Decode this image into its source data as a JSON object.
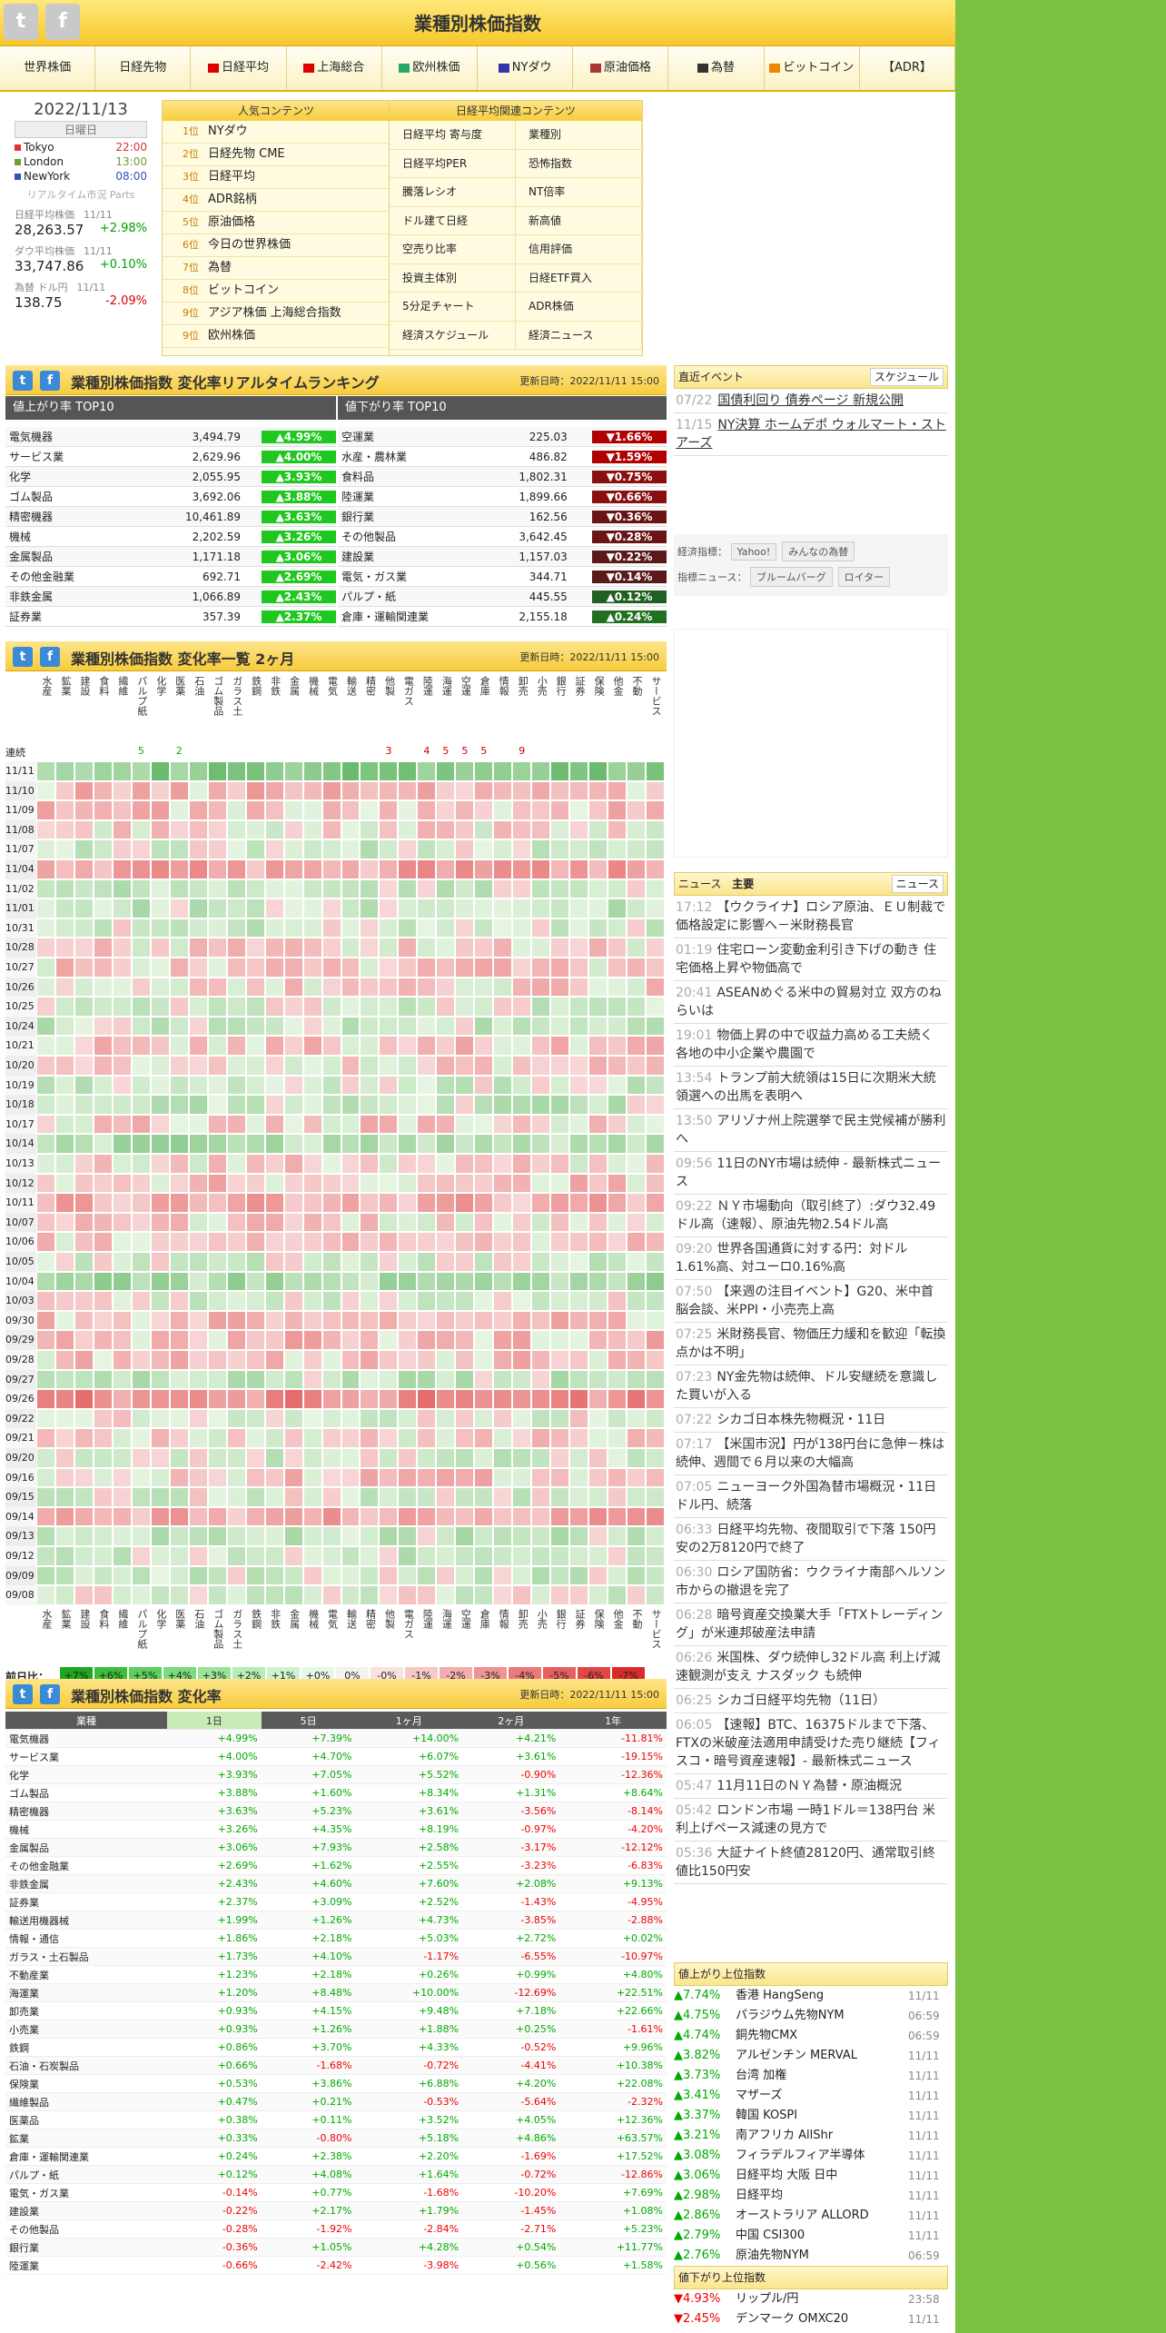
{
  "header": {
    "title": "業種別株価指数",
    "twitter": "t",
    "facebook": "f"
  },
  "nav": [
    "世界株価",
    "日経先物",
    "日経平均",
    "上海総合",
    "欧州株価",
    "NYダウ",
    "原油価格",
    "為替",
    "ビットコイン",
    "【ADR】"
  ],
  "datebox": {
    "date": "2022/11/13",
    "dow": "日曜日",
    "cities": [
      {
        "name": "Tokyo",
        "time": "22:00",
        "color": "#e03030"
      },
      {
        "name": "London",
        "time": "13:00",
        "color": "#70a030"
      },
      {
        "name": "NewYork",
        "time": "08:00",
        "color": "#3050c0"
      }
    ],
    "rt_label": "リアルタイム市況 Parts",
    "indices": [
      {
        "name": "日経平均株価",
        "date": "11/11",
        "value": "28,263.57",
        "chg": "+2.98%",
        "pos": true
      },
      {
        "name": "ダウ平均株価",
        "date": "11/11",
        "value": "33,747.86",
        "chg": "+0.10%",
        "pos": true
      },
      {
        "name": "為替 ドル円",
        "date": "11/11",
        "value": "138.75",
        "chg": "-2.09%",
        "pos": false
      }
    ]
  },
  "popular": {
    "title": "人気コンテンツ",
    "items": [
      {
        "rank": "1位",
        "label": "NYダウ"
      },
      {
        "rank": "2位",
        "label": "日経先物 CME"
      },
      {
        "rank": "3位",
        "label": "日経平均"
      },
      {
        "rank": "4位",
        "label": "ADR銘柄"
      },
      {
        "rank": "5位",
        "label": "原油価格"
      },
      {
        "rank": "6位",
        "label": "今日の世界株価"
      },
      {
        "rank": "7位",
        "label": "為替"
      },
      {
        "rank": "8位",
        "label": "ビットコイン"
      },
      {
        "rank": "9位",
        "label": "アジア株価 上海総合指数"
      },
      {
        "rank": "9位",
        "label": "欧州株価"
      }
    ]
  },
  "related": {
    "title": "日経平均関連コンテンツ",
    "left": [
      "日経平均 寄与度",
      "日経平均PER",
      "騰落レシオ",
      "ドル建て日経",
      "空売り比率",
      "投資主体別",
      "5分足チャート",
      "経済スケジュール"
    ],
    "right": [
      "業種別",
      "恐怖指数",
      "NT倍率",
      "新高値",
      "信用評価",
      "日経ETF買入",
      "ADR株価",
      "経済ニュース"
    ]
  },
  "ranking": {
    "title": "業種別株価指数 変化率リアルタイムランキング",
    "updated": "更新日時：2022/11/11 15:00",
    "up_title": "値上がり率 TOP10",
    "down_title": "値下がり率 TOP10",
    "up": [
      {
        "name": "電気機器",
        "value": "3,494.79",
        "chg": "▲4.99%"
      },
      {
        "name": "サービス業",
        "value": "2,629.96",
        "chg": "▲4.00%"
      },
      {
        "name": "化学",
        "value": "2,055.95",
        "chg": "▲3.93%"
      },
      {
        "name": "ゴム製品",
        "value": "3,692.06",
        "chg": "▲3.88%"
      },
      {
        "name": "精密機器",
        "value": "10,461.89",
        "chg": "▲3.63%"
      },
      {
        "name": "機械",
        "value": "2,202.59",
        "chg": "▲3.26%"
      },
      {
        "name": "金属製品",
        "value": "1,171.18",
        "chg": "▲3.06%"
      },
      {
        "name": "その他金融業",
        "value": "692.71",
        "chg": "▲2.69%"
      },
      {
        "name": "非鉄金属",
        "value": "1,066.89",
        "chg": "▲2.43%"
      },
      {
        "name": "証券業",
        "value": "357.39",
        "chg": "▲2.37%"
      }
    ],
    "down": [
      {
        "name": "空運業",
        "value": "225.03",
        "chg": "▼1.66%",
        "c": "#b00000"
      },
      {
        "name": "水産・農林業",
        "value": "486.82",
        "chg": "▼1.59%",
        "c": "#b00000"
      },
      {
        "name": "食料品",
        "value": "1,802.31",
        "chg": "▼0.75%",
        "c": "#8a1010"
      },
      {
        "name": "陸運業",
        "value": "1,899.66",
        "chg": "▼0.66%",
        "c": "#8a1010"
      },
      {
        "name": "銀行業",
        "value": "162.56",
        "chg": "▼0.36%",
        "c": "#6a1515"
      },
      {
        "name": "その他製品",
        "value": "3,642.45",
        "chg": "▼0.28%",
        "c": "#6a1515"
      },
      {
        "name": "建設業",
        "value": "1,157.03",
        "chg": "▼0.22%",
        "c": "#5a1a1a"
      },
      {
        "name": "電気・ガス業",
        "value": "344.71",
        "chg": "▼0.14%",
        "c": "#5a1a1a"
      },
      {
        "name": "パルプ・紙",
        "value": "445.55",
        "chg": "▲0.12%",
        "c": "#206020"
      },
      {
        "name": "倉庫・運輸関連業",
        "value": "2,155.18",
        "chg": "▲0.24%",
        "c": "#207020"
      }
    ]
  },
  "heatmap": {
    "title": "業種別株価指数 変化率一覧 2ヶ月",
    "updated": "更新日時：2022/11/11 15:00",
    "sectors": [
      "水産",
      "鉱業",
      "建設",
      "食料",
      "繊維",
      "パルプ紙",
      "化学",
      "医薬",
      "石油",
      "ゴム製品",
      "ガラス土",
      "鉄鋼",
      "非鉄",
      "金属",
      "機械",
      "電気",
      "輸送",
      "精密",
      "他製",
      "電ガス",
      "陸運",
      "海運",
      "空運",
      "倉庫",
      "情報",
      "卸売",
      "小売",
      "銀行",
      "証券",
      "保険",
      "他金",
      "不動",
      "サービス"
    ],
    "streak_label": "連続",
    "streaks": [
      "",
      "",
      "",
      "",
      "",
      "5",
      "",
      "2",
      "",
      "",
      "",
      "",
      "",
      "",
      "",
      "",
      "",
      "",
      "3",
      "",
      "4",
      "5",
      "5",
      "5",
      "",
      "9",
      "",
      "",
      "",
      "",
      "",
      "",
      ""
    ],
    "dates": [
      "11/11",
      "11/10",
      "11/09",
      "11/08",
      "11/07",
      "11/04",
      "11/02",
      "11/01",
      "10/31",
      "10/28",
      "10/27",
      "10/26",
      "10/25",
      "10/24",
      "10/21",
      "10/20",
      "10/19",
      "10/18",
      "10/17",
      "10/14",
      "10/13",
      "10/12",
      "10/11",
      "10/07",
      "10/06",
      "10/05",
      "10/04",
      "10/03",
      "09/30",
      "09/29",
      "09/28",
      "09/27",
      "09/26",
      "09/22",
      "09/21",
      "09/20",
      "09/16",
      "09/15",
      "09/14",
      "09/13",
      "09/12",
      "09/09",
      "09/08"
    ],
    "legend_label": "前日比：",
    "legend": [
      "+7%",
      "+6%",
      "+5%",
      "+4%",
      "+3%",
      "+2%",
      "+1%",
      "+0%",
      "0%",
      "-0%",
      "-1%",
      "-2%",
      "-3%",
      "-4%",
      "-5%",
      "-6%",
      "-7%"
    ]
  },
  "table": {
    "title": "業種別株価指数 変化率",
    "updated": "更新日時：2022/11/11 15:00",
    "cols": [
      "業種",
      "1日",
      "5日",
      "1ヶ月",
      "2ヶ月",
      "1年"
    ],
    "rows": [
      [
        "電気機器",
        "+4.99%",
        "+7.39%",
        "+14.00%",
        "+4.21%",
        "-11.81%"
      ],
      [
        "サービス業",
        "+4.00%",
        "+4.70%",
        "+6.07%",
        "+3.61%",
        "-19.15%"
      ],
      [
        "化学",
        "+3.93%",
        "+7.05%",
        "+5.52%",
        "-0.90%",
        "-12.36%"
      ],
      [
        "ゴム製品",
        "+3.88%",
        "+1.60%",
        "+8.34%",
        "+1.31%",
        "+8.64%"
      ],
      [
        "精密機器",
        "+3.63%",
        "+5.23%",
        "+3.61%",
        "-3.56%",
        "-8.14%"
      ],
      [
        "機械",
        "+3.26%",
        "+4.35%",
        "+8.19%",
        "-0.97%",
        "-4.20%"
      ],
      [
        "金属製品",
        "+3.06%",
        "+7.93%",
        "+2.58%",
        "-3.17%",
        "-12.12%"
      ],
      [
        "その他金融業",
        "+2.69%",
        "+1.62%",
        "+2.55%",
        "-3.23%",
        "-6.83%"
      ],
      [
        "非鉄金属",
        "+2.43%",
        "+4.60%",
        "+7.60%",
        "+2.08%",
        "+9.13%"
      ],
      [
        "証券業",
        "+2.37%",
        "+3.09%",
        "+2.52%",
        "-1.43%",
        "-4.95%"
      ],
      [
        "輸送用機器械",
        "+1.99%",
        "+1.26%",
        "+4.73%",
        "-3.85%",
        "-2.88%"
      ],
      [
        "情報・通信",
        "+1.86%",
        "+2.18%",
        "+5.03%",
        "+2.72%",
        "+0.02%"
      ],
      [
        "ガラス・土石製品",
        "+1.73%",
        "+4.10%",
        "-1.17%",
        "-6.55%",
        "-10.97%"
      ],
      [
        "不動産業",
        "+1.23%",
        "+2.18%",
        "+0.26%",
        "+0.99%",
        "+4.80%"
      ],
      [
        "海運業",
        "+1.20%",
        "+8.48%",
        "+10.00%",
        "-12.69%",
        "+22.51%"
      ],
      [
        "卸売業",
        "+0.93%",
        "+4.15%",
        "+9.48%",
        "+7.18%",
        "+22.66%"
      ],
      [
        "小売業",
        "+0.93%",
        "+1.26%",
        "+1.88%",
        "+0.25%",
        "-1.61%"
      ],
      [
        "鉄鋼",
        "+0.86%",
        "+3.70%",
        "+4.33%",
        "-0.52%",
        "+9.96%"
      ],
      [
        "石油・石炭製品",
        "+0.66%",
        "-1.68%",
        "-0.72%",
        "-4.41%",
        "+10.38%"
      ],
      [
        "保険業",
        "+0.53%",
        "+3.86%",
        "+6.88%",
        "+4.20%",
        "+22.08%"
      ],
      [
        "繊維製品",
        "+0.47%",
        "+0.21%",
        "-0.53%",
        "-5.64%",
        "-2.32%"
      ],
      [
        "医薬品",
        "+0.38%",
        "+0.11%",
        "+3.52%",
        "+4.05%",
        "+12.36%"
      ],
      [
        "鉱業",
        "+0.33%",
        "-0.80%",
        "+5.18%",
        "+4.86%",
        "+63.57%"
      ],
      [
        "倉庫・運輸関連業",
        "+0.24%",
        "+2.38%",
        "+2.20%",
        "-1.69%",
        "+17.52%"
      ],
      [
        "パルプ・紙",
        "+0.12%",
        "+4.08%",
        "+1.64%",
        "-0.72%",
        "-12.86%"
      ],
      [
        "電気・ガス業",
        "-0.14%",
        "+0.77%",
        "-1.68%",
        "-10.20%",
        "+7.69%"
      ],
      [
        "建設業",
        "-0.22%",
        "+2.17%",
        "+1.79%",
        "-1.45%",
        "+1.08%"
      ],
      [
        "その他製品",
        "-0.28%",
        "-1.92%",
        "-2.84%",
        "-2.71%",
        "+5.23%"
      ],
      [
        "銀行業",
        "-0.36%",
        "+1.05%",
        "+4.28%",
        "+0.54%",
        "+11.77%"
      ],
      [
        "陸運業",
        "-0.66%",
        "-2.42%",
        "-3.98%",
        "+0.56%",
        "+1.58%"
      ]
    ]
  },
  "events": {
    "title": "直近イベント",
    "button": "スケジュール",
    "items": [
      {
        "date": "07/22",
        "text": "国債利回り 債券ページ 新規公開"
      },
      {
        "date": "11/15",
        "text": "NY決算 ホームデポ ウォルマート・ストアーズ"
      }
    ],
    "econ_label": "経済指標：",
    "econ_links": [
      "Yahoo!",
      "みんなの為替"
    ],
    "news_label": "指標ニュース：",
    "news_links": [
      "ブルームバーグ",
      "ロイター"
    ]
  },
  "news": {
    "title": "ニュース",
    "tab": "主要",
    "button": "ニュース",
    "items": [
      {
        "t": "17:12",
        "x": "【ウクライナ】ロシア原油、ＥＵ制裁で価格設定に影響へ－米財務長官"
      },
      {
        "t": "01:19",
        "x": "住宅ローン変動金利引き下げの動き 住宅価格上昇や物価高で"
      },
      {
        "t": "20:41",
        "x": "ASEANめぐる米中の貿易対立 双方のねらいは"
      },
      {
        "t": "19:01",
        "x": "物価上昇の中で収益力高める工夫続く 各地の中小企業や農園で"
      },
      {
        "t": "13:54",
        "x": "トランプ前大統領は15日に次期米大統領選への出馬を表明へ"
      },
      {
        "t": "13:50",
        "x": "アリゾナ州上院選挙で民主党候補が勝利へ"
      },
      {
        "t": "09:56",
        "x": "11日のNY市場は続伸 - 最新株式ニュース"
      },
      {
        "t": "09:22",
        "x": "ＮＹ市場動向（取引終了）:ダウ32.49ドル高（速報）、原油先物2.54ドル高"
      },
      {
        "t": "09:20",
        "x": "世界各国通貨に対する円：対ドル1.61%高、対ユーロ0.16%高"
      },
      {
        "t": "07:50",
        "x": "【来週の注目イベント】G20、米中首脳会談、米PPI・小売売上高"
      },
      {
        "t": "07:25",
        "x": "米財務長官、物価圧力緩和を歓迎「転換点かは不明」"
      },
      {
        "t": "07:23",
        "x": "NY金先物は続伸、ドル安継続を意識した買いが入る"
      },
      {
        "t": "07:22",
        "x": "シカゴ日本株先物概況・11日"
      },
      {
        "t": "07:17",
        "x": "【米国市況】円が138円台に急伸－株は続伸、週間で６月以来の大幅高"
      },
      {
        "t": "07:05",
        "x": "ニューヨーク外国為替市場概況・11日 ドル円、続落"
      },
      {
        "t": "06:33",
        "x": "日経平均先物、夜間取引で下落 150円安の2万8120円で終了"
      },
      {
        "t": "06:30",
        "x": "ロシア国防省：ウクライナ南部ヘルソン市からの撤退を完了"
      },
      {
        "t": "06:28",
        "x": "暗号資産交換業大手「FTXトレーディング」が米連邦破産法申請"
      },
      {
        "t": "06:26",
        "x": "米国株、ダウ続伸し32ドル高 利上げ減速観測が支え ナスダック も続伸"
      },
      {
        "t": "06:25",
        "x": "シカゴ日経平均先物（11日）"
      },
      {
        "t": "06:05",
        "x": "【速報】BTC、16375ドルまで下落、FTXの米破産法適用申請受けた売り継続【フィスコ・暗号資産速報】- 最新株式ニュース"
      },
      {
        "t": "05:47",
        "x": "11月11日のＮＹ為替・原油概況"
      },
      {
        "t": "05:42",
        "x": "ロンドン市場 一時1ドル＝138円台 米利上げペース減速の見方で"
      },
      {
        "t": "05:36",
        "x": "大証ナイト終値28120円、通常取引終値比150円安"
      }
    ]
  },
  "gainers": {
    "title": "値上がり上位指数",
    "items": [
      {
        "c": "▲7.74%",
        "n": "香港 HangSeng",
        "d": "11/11"
      },
      {
        "c": "▲4.75%",
        "n": "パラジウム先物NYM",
        "d": "06:59"
      },
      {
        "c": "▲4.74%",
        "n": "銅先物CMX",
        "d": "06:59"
      },
      {
        "c": "▲3.82%",
        "n": "アルゼンチン MERVAL",
        "d": "11/11"
      },
      {
        "c": "▲3.73%",
        "n": "台湾 加権",
        "d": "11/11"
      },
      {
        "c": "▲3.41%",
        "n": "マザーズ",
        "d": "11/11"
      },
      {
        "c": "▲3.37%",
        "n": "韓国 KOSPI",
        "d": "11/11"
      },
      {
        "c": "▲3.21%",
        "n": "南アフリカ AllShr",
        "d": "11/11"
      },
      {
        "c": "▲3.08%",
        "n": "フィラデルフィア半導体",
        "d": "11/11"
      },
      {
        "c": "▲3.06%",
        "n": "日経平均 大阪 日中",
        "d": "11/11"
      },
      {
        "c": "▲2.98%",
        "n": "日経平均",
        "d": "11/11"
      },
      {
        "c": "▲2.86%",
        "n": "オーストラリア ALLORD",
        "d": "11/11"
      },
      {
        "c": "▲2.79%",
        "n": "中国 CSI300",
        "d": "11/11"
      },
      {
        "c": "▲2.76%",
        "n": "原油先物NYM",
        "d": "06:59"
      }
    ]
  },
  "losers": {
    "title": "値下がり上位指数",
    "items": [
      {
        "c": "▼4.93%",
        "n": "リップル/円",
        "d": "23:58"
      },
      {
        "c": "▼2.45%",
        "n": "デンマーク OMXC20",
        "d": "11/11"
      }
    ]
  }
}
